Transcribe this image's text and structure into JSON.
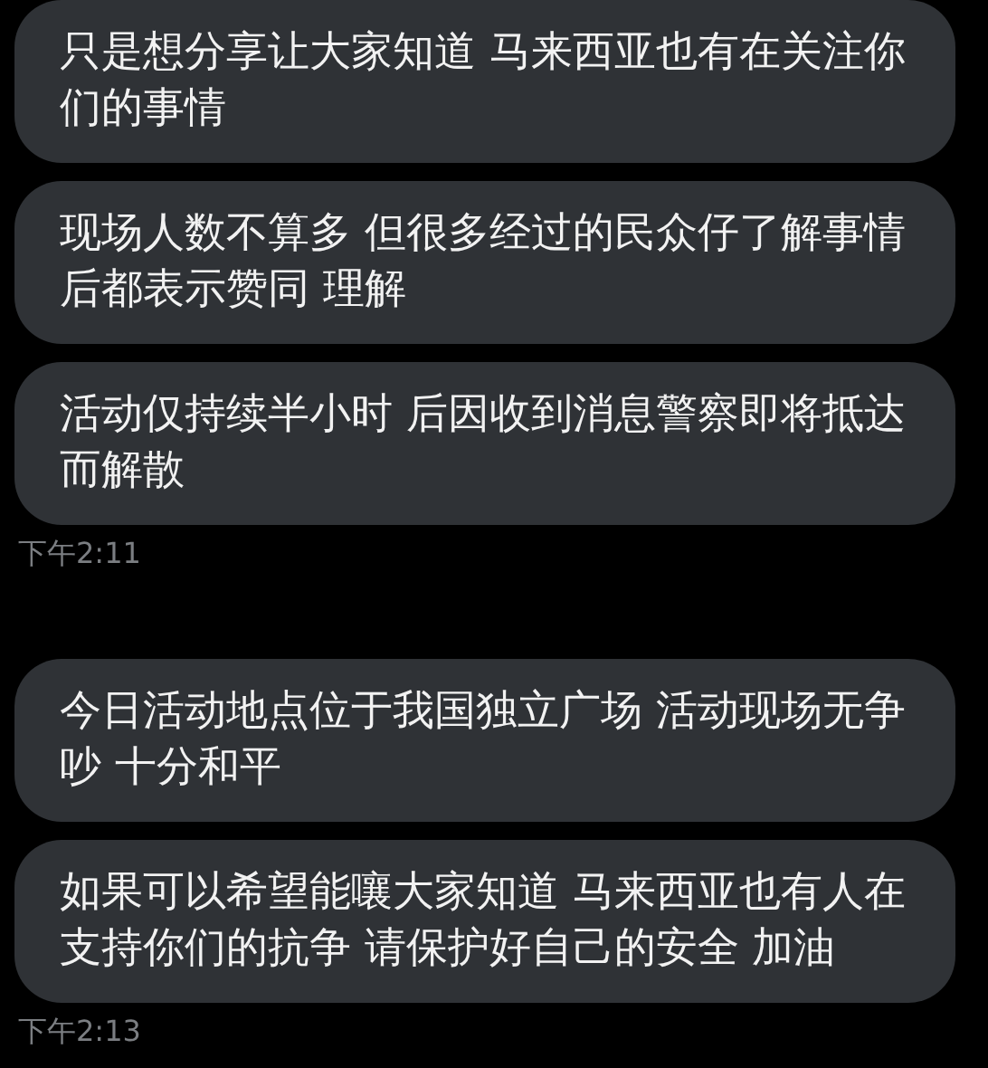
{
  "items": [
    {
      "kind": "message",
      "text": "只是想分享让大家知道 马来西亚也有在关注你们的事情"
    },
    {
      "kind": "message",
      "text": "现场人数不算多 但很多经过的民众仔了解事情后都表示赞同 理解"
    },
    {
      "kind": "message",
      "text": "活动仅持续半小时 后因收到消息警察即将抵达而解散"
    },
    {
      "kind": "timestamp",
      "text": "下午2:11"
    },
    {
      "kind": "message",
      "text": "今日活动地点位于我国独立广场 活动现场无争吵 十分和平"
    },
    {
      "kind": "message",
      "text": "如果可以希望能嚷大家知道 马来西亚也有人在支持你们的抗争 请保护好自己的安全 加油"
    },
    {
      "kind": "timestamp",
      "text": "下午2:13"
    }
  ]
}
